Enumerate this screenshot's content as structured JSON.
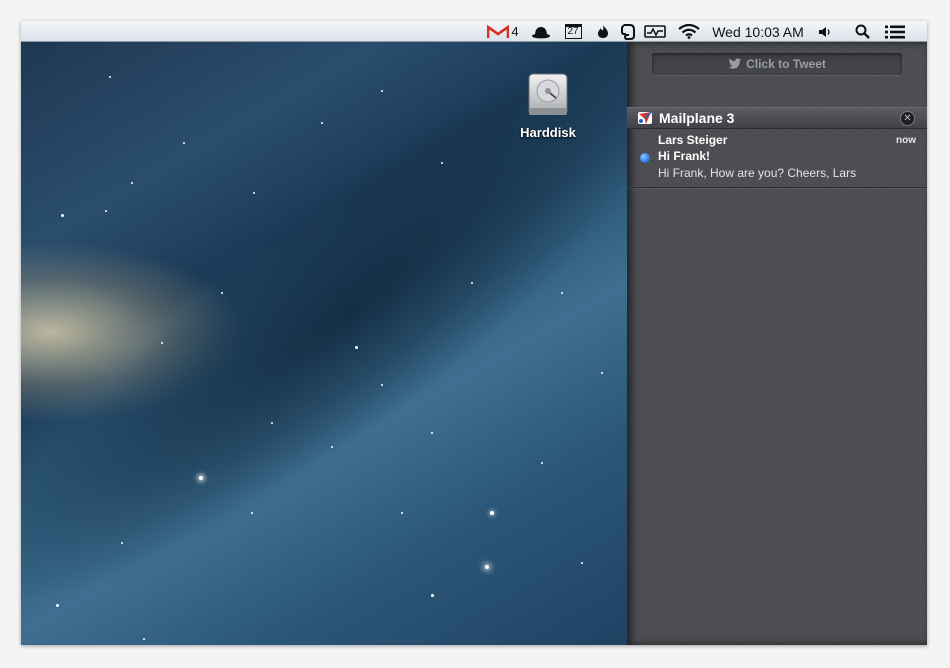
{
  "menubar": {
    "gmail_count": "4",
    "calendar_day": "27",
    "clock": "Wed 10:03 AM"
  },
  "desktop": {
    "icons": [
      {
        "label": "Harddisk"
      }
    ]
  },
  "notification_center": {
    "tweet_button": "Click to Tweet",
    "sections": [
      {
        "app": "Mailplane 3",
        "notifications": [
          {
            "sender": "Lars Steiger",
            "time": "now",
            "subject": "Hi Frank!",
            "body": "Hi Frank, How are you? Cheers, Lars",
            "unread": true
          }
        ]
      }
    ]
  },
  "colors": {
    "gmail_red": "#d93025",
    "unread_blue": "#2f7de6",
    "panel_bg": "#4b4d51"
  }
}
